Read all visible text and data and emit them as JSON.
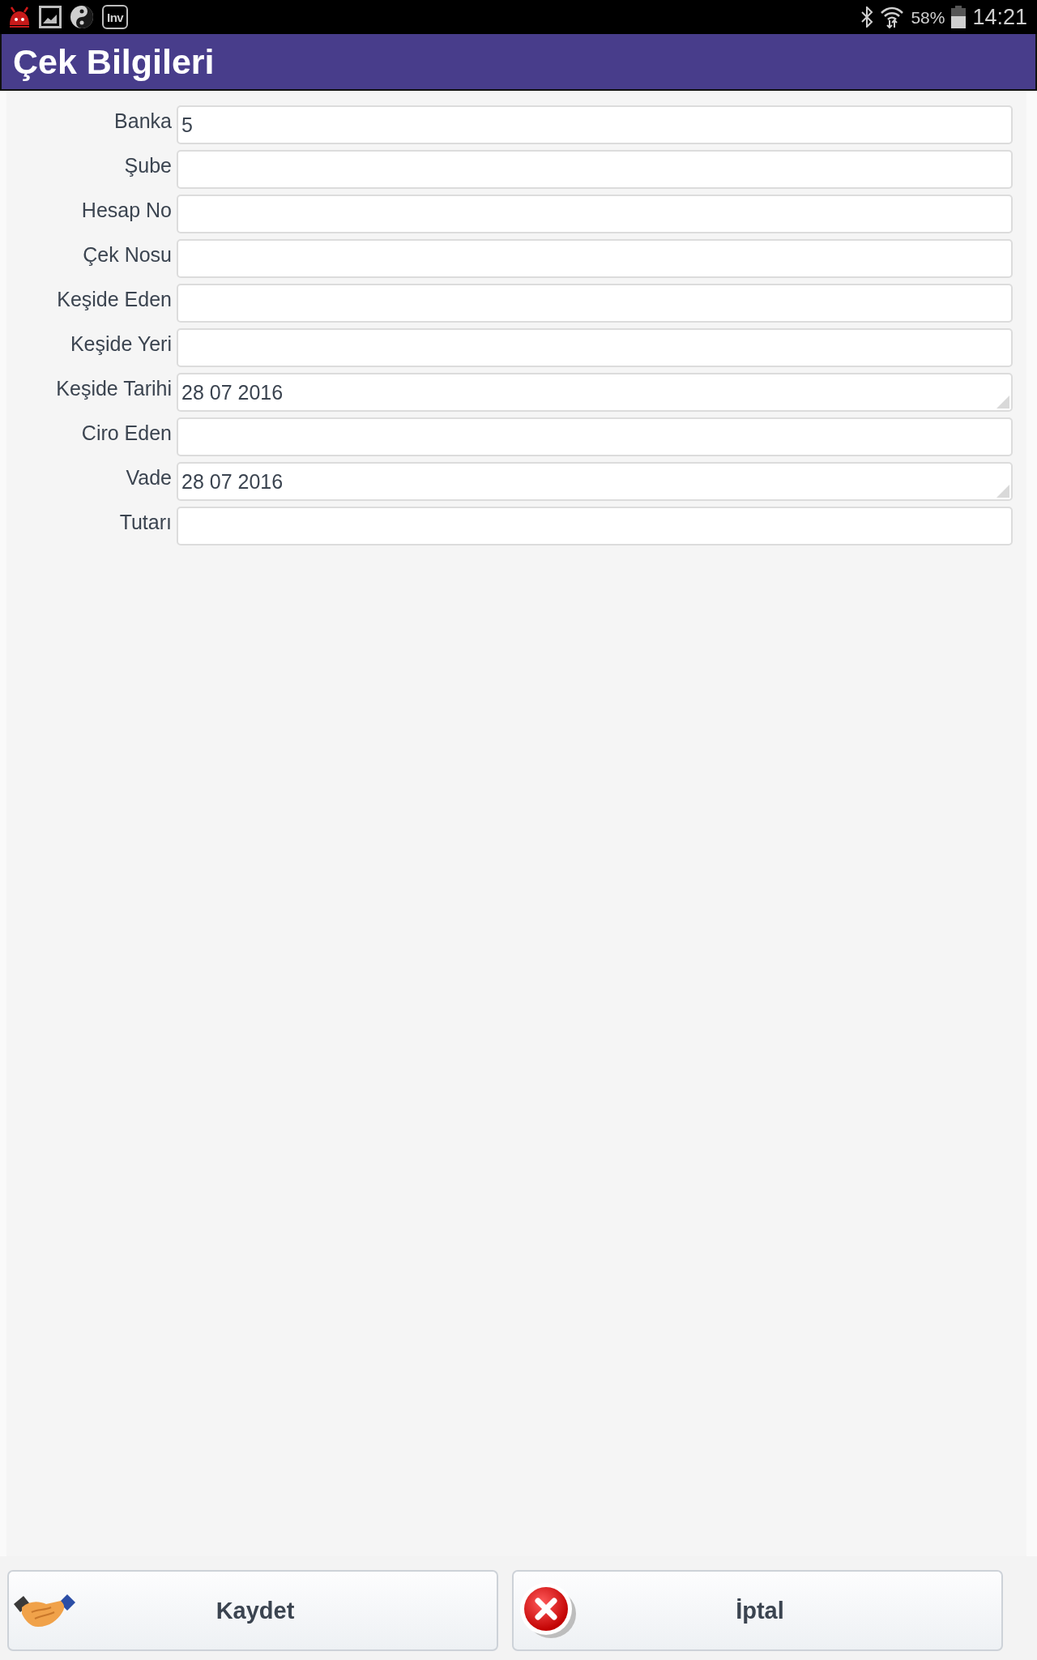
{
  "status_bar": {
    "app_label": "Inv",
    "battery_percent": "58%",
    "time": "14:21"
  },
  "title_bar": {
    "title": "Çek Bilgileri"
  },
  "form": {
    "fields": [
      {
        "label": "Banka",
        "value": "5",
        "kind": "text"
      },
      {
        "label": "Şube",
        "kind": "text"
      },
      {
        "label": "Hesap No",
        "kind": "text"
      },
      {
        "label": "Çek Nosu",
        "kind": "text"
      },
      {
        "label": "Keşide Eden",
        "kind": "text"
      },
      {
        "label": "Keşide Yeri",
        "kind": "text"
      },
      {
        "label": "Keşide Tarihi",
        "value": "28 07 2016",
        "kind": "date"
      },
      {
        "label": "Ciro Eden",
        "kind": "text"
      },
      {
        "label": "Vade",
        "value": "28 07 2016",
        "kind": "date"
      },
      {
        "label": "Tutarı",
        "kind": "text"
      }
    ]
  },
  "buttons": [
    {
      "label": "Kaydet",
      "kind": "save"
    },
    {
      "label": "İptal",
      "kind": "cancel"
    }
  ]
}
